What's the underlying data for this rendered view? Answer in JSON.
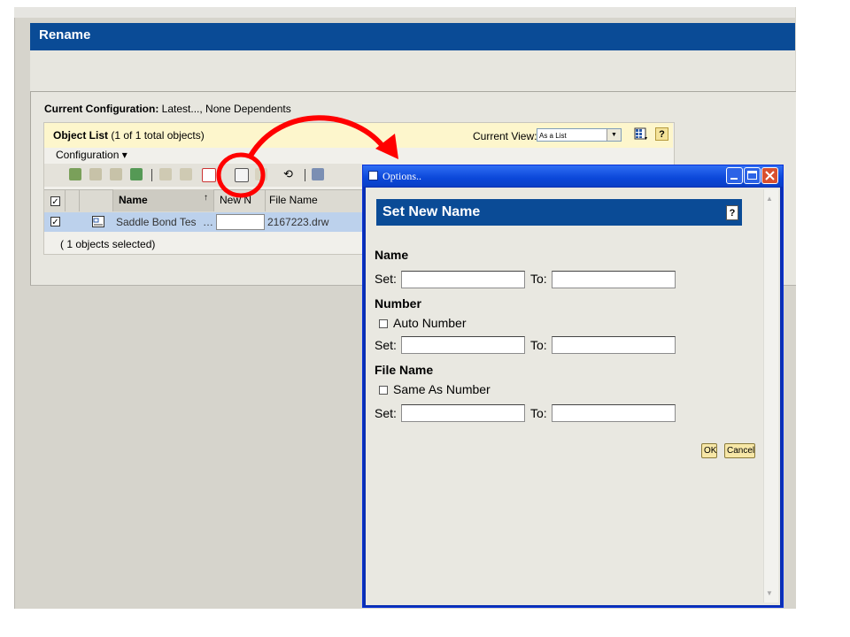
{
  "app": {
    "title": "Rename",
    "current_configuration_label": "Current Configuration:",
    "current_configuration_value": "Latest..., None Dependents",
    "object_list": {
      "title": "Object List",
      "count_text": "(1 of 1 total objects)",
      "current_view_label": "Current View:",
      "current_view_value": "As a List",
      "help": "?"
    },
    "configuration_menu": "Configuration",
    "columns": [
      "Name",
      "New N",
      "File Name"
    ],
    "sort_indicator": "↑",
    "rows": [
      {
        "checked": "✓",
        "name": "Saddle Bond Tes",
        "more": "…",
        "new_name": "",
        "file_name": "2167223.drw"
      }
    ],
    "selected_note": "( 1 objects selected)"
  },
  "dialog": {
    "title": "Options..",
    "header": "Set New Name",
    "help": "?",
    "name_section": "Name",
    "number_section": "Number",
    "auto_number_label": "Auto Number",
    "file_name_section": "File Name",
    "same_as_number_label": "Same As Number",
    "set_label": "Set:",
    "to_label": "To:",
    "ok_label": "OK",
    "cancel_label": "Cancel"
  },
  "colors": {
    "header_blue": "#0a4b96",
    "annotation_red": "#ff0000",
    "xp_title_blue": "#0b47d9"
  }
}
